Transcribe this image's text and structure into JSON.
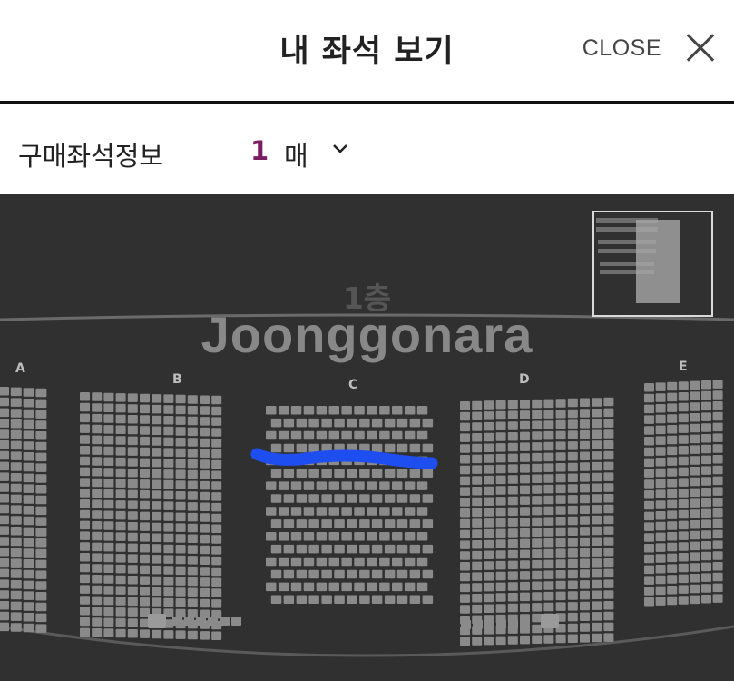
{
  "header": {
    "title": "내 좌석 보기",
    "close_label": "CLOSE"
  },
  "purchase_info": {
    "label": "구매좌석정보",
    "count": "1",
    "unit": "매"
  },
  "seat_map": {
    "floor_label": "1층",
    "watermark": "Joonggonara",
    "sections": [
      "A",
      "B",
      "C",
      "D",
      "E"
    ],
    "highlight_color": "#1f4ef0"
  },
  "colors": {
    "accent": "#7a1d61",
    "map_background": "#303030",
    "seat": "#8a8a8a"
  }
}
